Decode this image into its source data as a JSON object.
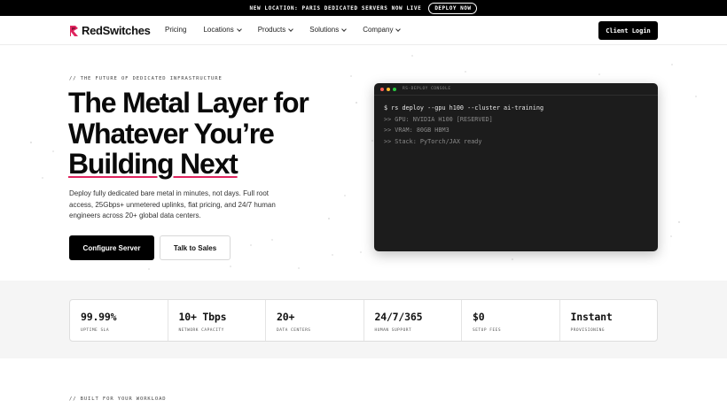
{
  "announcement": {
    "text": "NEW LOCATION: PARIS DEDICATED SERVERS NOW LIVE",
    "cta": "DEPLOY NOW"
  },
  "nav": {
    "logo": "RedSwitches",
    "items": [
      {
        "label": "Pricing",
        "dropdown": false
      },
      {
        "label": "Locations",
        "dropdown": true
      },
      {
        "label": "Products",
        "dropdown": true
      },
      {
        "label": "Solutions",
        "dropdown": true
      },
      {
        "label": "Company",
        "dropdown": true
      }
    ],
    "client_login": "Client Login"
  },
  "hero": {
    "eyebrow": "// THE FUTURE OF DEDICATED INFRASTRUCTURE",
    "headline_line1": "The Metal Layer for",
    "headline_line2": "Whatever You’re",
    "headline_line3": "Building Next",
    "description": "Deploy fully dedicated bare metal in minutes, not days. Full root access, 25Gbps+ unmetered uplinks, flat pricing, and 24/7 human engineers across 20+ global data centers.",
    "primary_cta": "Configure Server",
    "secondary_cta": "Talk to Sales"
  },
  "console": {
    "title": "RS-DEPLOY CONSOLE",
    "command": "$ rs deploy --gpu h100 --cluster ai-training",
    "outputs": [
      ">> GPU: NVIDIA H100 [RESERVED]",
      ">> VRAM: 80GB HBM3",
      ">> Stack: PyTorch/JAX ready"
    ]
  },
  "stats": [
    {
      "value": "99.99%",
      "label": "UPTIME SLA"
    },
    {
      "value": "10+ Tbps",
      "label": "NETWORK CAPACITY"
    },
    {
      "value": "20+",
      "label": "DATA CENTERS"
    },
    {
      "value": "24/7/365",
      "label": "HUMAN SUPPORT"
    },
    {
      "value": "$0",
      "label": "SETUP FEES"
    },
    {
      "value": "Instant",
      "label": "PROVISIONING"
    }
  ],
  "next_section": {
    "eyebrow": "// BUILT FOR YOUR WORKLOAD"
  },
  "colors": {
    "brand_red": "#e0245e",
    "dark": "#000000",
    "console_bg": "#1c1c1c",
    "dot_red": "#ff5f57",
    "dot_yellow": "#febc2e",
    "dot_green": "#28c840"
  }
}
